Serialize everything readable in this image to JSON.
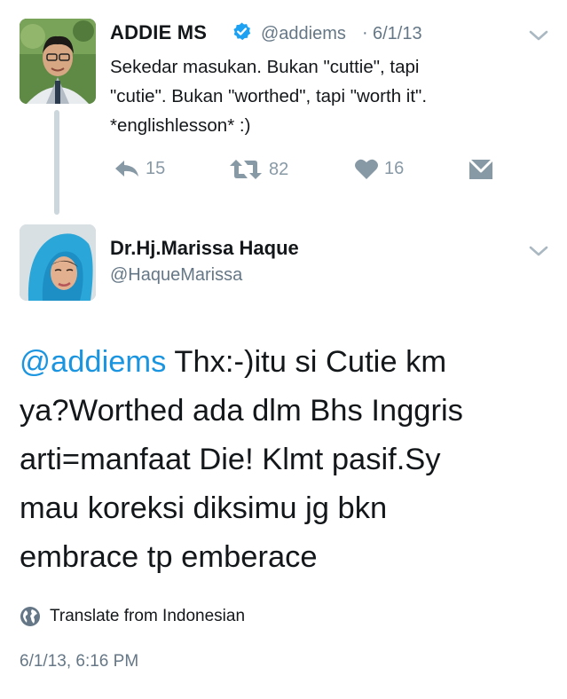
{
  "parent_tweet": {
    "author_name": "ADDIE MS",
    "handle": "@addiems",
    "separator": "·",
    "date": "6/1/13",
    "text_lines": [
      "Sekedar masukan. Bukan \"cuttie\", tapi",
      "\"cutie\". Bukan \"worthed\", tapi \"worth it\".",
      "*englishlesson* :)"
    ],
    "actions": {
      "reply_count": "15",
      "retweet_count": "82",
      "like_count": "16"
    }
  },
  "reply_tweet": {
    "author_name": "Dr.Hj.Marissa Haque",
    "handle": "@HaqueMarissa",
    "mention": "@addiems",
    "text_lines": [
      " Thx:-)itu si Cutie km",
      "ya?Worthed ada dlm Bhs Inggris",
      "arti=manfaat Die! Klmt pasif.Sy",
      "mau koreksi diksimu jg bkn",
      "embrace tp emberace"
    ],
    "translate_label": "Translate from Indonesian",
    "timestamp": "6/1/13, 6:16 PM"
  },
  "colors": {
    "verified_blue": "#1da1f2",
    "mention_blue": "#1b95e0",
    "action_gray": "#8899a6",
    "secondary_text": "#657786",
    "thread_line": "#ccd6dd"
  },
  "icons": [
    "verified-badge-icon",
    "chevron-down-icon",
    "reply-icon",
    "retweet-icon",
    "heart-icon",
    "direct-message-icon",
    "globe-icon"
  ]
}
